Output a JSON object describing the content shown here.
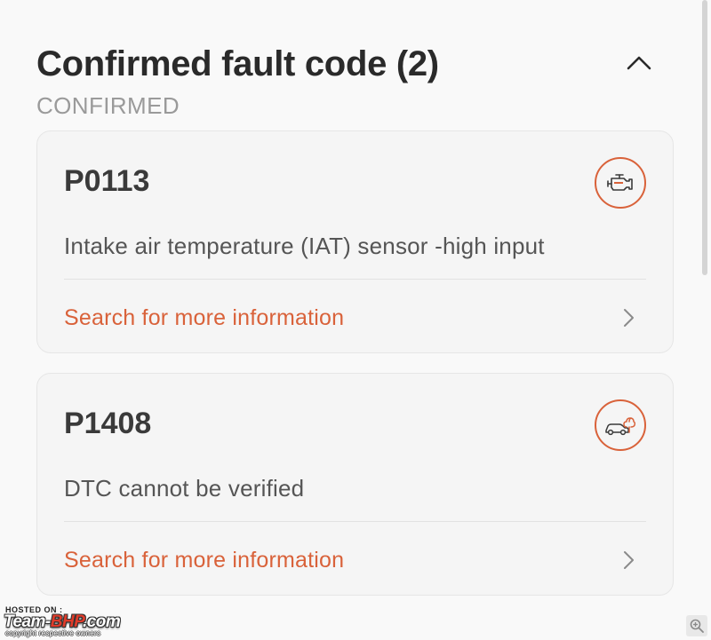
{
  "section": {
    "title": "Confirmed fault code (2)",
    "subtitle": "CONFIRMED",
    "collapse_icon": "chevron-up-icon"
  },
  "fault_codes": [
    {
      "code": "P0113",
      "description": "Intake air temperature (IAT) sensor -high input",
      "link_label": "Search for more information",
      "icon": "engine-icon"
    },
    {
      "code": "P1408",
      "description": "DTC cannot be verified",
      "link_label": "Search for more information",
      "icon": "car-emission-icon"
    }
  ],
  "watermark": {
    "hosted_on": "HOSTED ON :",
    "brand_prefix": "Team-",
    "brand_highlight": "BHP",
    "brand_suffix": ".com",
    "copyright": "copyright respective owners"
  },
  "zoom_icon": "zoom-in-icon",
  "colors": {
    "accent": "#d9623a",
    "background": "#f9f9f9",
    "card_background": "#f5f5f5",
    "title": "#2a2a2a",
    "subtitle": "#9a9a9a"
  }
}
